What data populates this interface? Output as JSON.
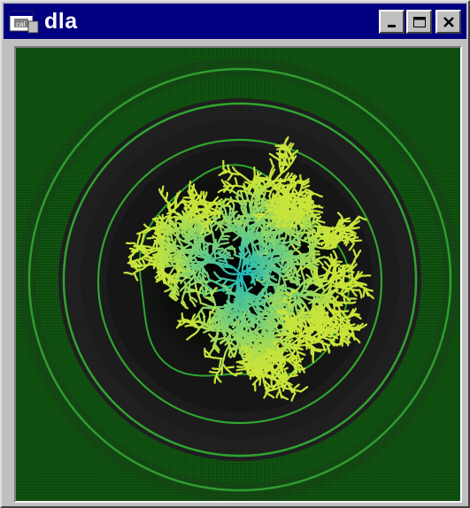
{
  "window": {
    "title": "dla",
    "icon": "app-window-icon",
    "controls": [
      "minimize-icon",
      "maximize-icon",
      "close-icon"
    ]
  },
  "canvas": {
    "description_icon": "dla-fractal",
    "colors": {
      "background": "#0e4a0e",
      "ring": "#2fa52f",
      "dark_band": "#1e1f1e",
      "core": "#050805",
      "cluster_inner": "#19b8c0",
      "cluster_outer": "#c8e43a"
    }
  }
}
